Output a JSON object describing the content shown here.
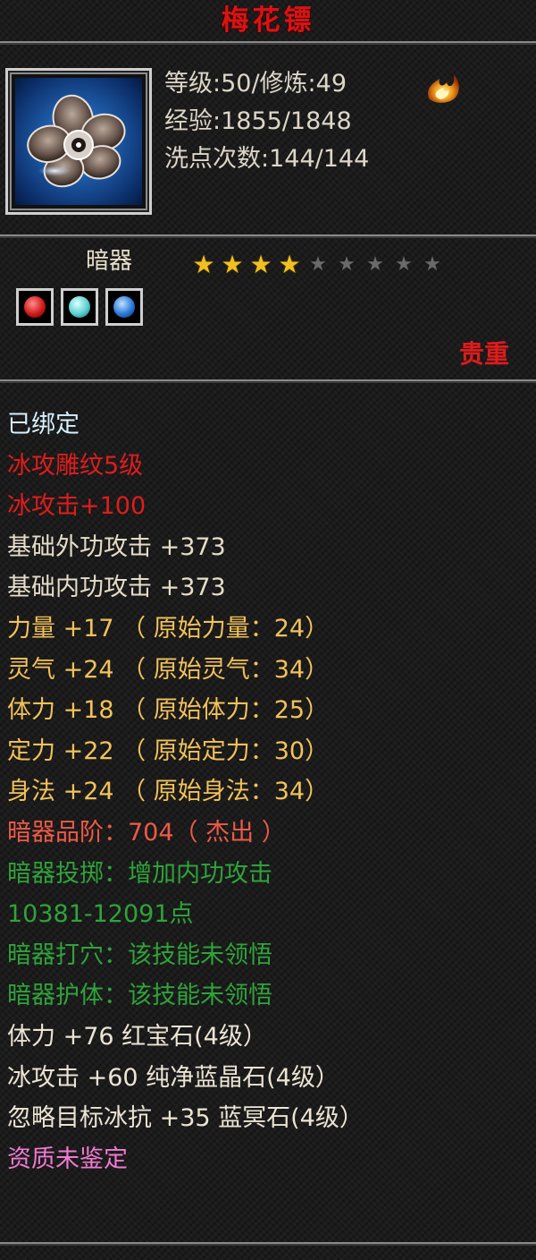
{
  "item": {
    "name": "梅花镖",
    "level_line": "等级:50/修炼:49",
    "exp_line": "经验:1855/1848",
    "wash_line": "洗点次数:144/144",
    "type": "暗器",
    "stars_filled": 4,
    "stars_total": 9,
    "rarity_label": "贵重",
    "gems": [
      "red-gem-icon",
      "cyan-gem-icon",
      "blue-gem-icon"
    ]
  },
  "colors": {
    "white": "#dcf0ff",
    "red": "#e01c1c",
    "cream": "#e6ddc8",
    "gold": "#f2c25a",
    "salmon": "#ef5a48",
    "green": "#2fa33a",
    "pink": "#f07ad2"
  },
  "attributes": [
    {
      "text": "已绑定",
      "color": "#d8f0ff"
    },
    {
      "text": "冰攻雕纹5级",
      "color": "#e01c1c"
    },
    {
      "text": "冰攻击+100",
      "color": "#e01c1c"
    },
    {
      "text": "基础外功攻击 +373",
      "color": "#e6ddc8"
    },
    {
      "text": "基础内功攻击 +373",
      "color": "#e6ddc8"
    },
    {
      "text": "力量 +17 （ 原始力量：24）",
      "color": "#f2c25a"
    },
    {
      "text": "灵气 +24 （ 原始灵气：34）",
      "color": "#f2c25a"
    },
    {
      "text": "体力 +18 （ 原始体力：25）",
      "color": "#f2c25a"
    },
    {
      "text": "定力 +22 （ 原始定力：30）",
      "color": "#f2c25a"
    },
    {
      "text": "身法 +24 （ 原始身法：34）",
      "color": "#f2c25a"
    },
    {
      "text": "暗器品阶：704（ 杰出 ）",
      "color": "#ef5a48"
    },
    {
      "text": "暗器投掷：增加内功攻击",
      "color": "#2fa33a"
    },
    {
      "text": "10381-12091点",
      "color": "#2fa33a"
    },
    {
      "text": "暗器打穴：该技能未领悟",
      "color": "#2fa33a"
    },
    {
      "text": "暗器护体：该技能未领悟",
      "color": "#2fa33a"
    },
    {
      "text": "体力 +76 红宝石(4级）",
      "color": "#ece4d4"
    },
    {
      "text": "冰攻击 +60 纯净蓝晶石(4级）",
      "color": "#ece4d4"
    },
    {
      "text": "忽略目标冰抗 +35 蓝冥石(4级）",
      "color": "#ece4d4"
    },
    {
      "text": "资质未鉴定",
      "color": "#f07ad2"
    }
  ]
}
